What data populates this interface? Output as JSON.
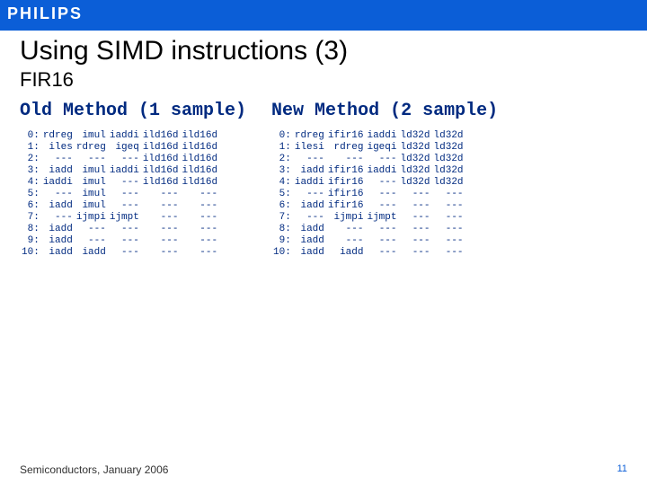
{
  "brand": "PHILIPS",
  "title": "Using SIMD instructions (3)",
  "subtitle": "FIR16",
  "left": {
    "heading": "Old Method (1 sample)",
    "rows": [
      [
        "0:",
        "rdreg",
        "imul",
        "iaddi",
        "ild16d",
        "ild16d"
      ],
      [
        "1:",
        "iles",
        "rdreg",
        "igeq",
        "ild16d",
        "ild16d"
      ],
      [
        "2:",
        "---",
        "---",
        "---",
        "ild16d",
        "ild16d"
      ],
      [
        "3:",
        "iadd",
        "imul",
        "iaddi",
        "ild16d",
        "ild16d"
      ],
      [
        "4:",
        "iaddi",
        "imul",
        "---",
        "ild16d",
        "ild16d"
      ],
      [
        "5:",
        "---",
        "imul",
        "---",
        "---",
        "---"
      ],
      [
        "6:",
        "iadd",
        "imul",
        "---",
        "---",
        "---"
      ],
      [
        "7:",
        "---",
        "ijmpi",
        "ijmpt",
        "---",
        "---"
      ],
      [
        "8:",
        "iadd",
        "---",
        "---",
        "---",
        "---"
      ],
      [
        "9:",
        "iadd",
        "---",
        "---",
        "---",
        "---"
      ],
      [
        "10:",
        "iadd",
        "iadd",
        "---",
        "---",
        "---"
      ]
    ]
  },
  "right": {
    "heading": "New Method (2 sample)",
    "rows": [
      [
        "0:",
        "rdreg",
        "ifir16",
        "iaddi",
        "ld32d",
        "ld32d"
      ],
      [
        "1:",
        "ilesi",
        "rdreg",
        "igeqi",
        "ld32d",
        "ld32d"
      ],
      [
        "2:",
        "---",
        "---",
        "---",
        "ld32d",
        "ld32d"
      ],
      [
        "3:",
        "iadd",
        "ifir16",
        "iaddi",
        "ld32d",
        "ld32d"
      ],
      [
        "4:",
        "iaddi",
        "ifir16",
        "---",
        "ld32d",
        "ld32d"
      ],
      [
        "5:",
        "---",
        "ifir16",
        "---",
        "---",
        "---"
      ],
      [
        "6:",
        "iadd",
        "ifir16",
        "---",
        "---",
        "---"
      ],
      [
        "7:",
        "---",
        "ijmpi",
        "ijmpt",
        "---",
        "---"
      ],
      [
        "8:",
        "iadd",
        "---",
        "---",
        "---",
        "---"
      ],
      [
        "9:",
        "iadd",
        "---",
        "---",
        "---",
        "---"
      ],
      [
        "10:",
        "iadd",
        "iadd",
        "---",
        "---",
        "---"
      ]
    ]
  },
  "footer": {
    "left": "Semiconductors, January 2006",
    "page": "11"
  }
}
